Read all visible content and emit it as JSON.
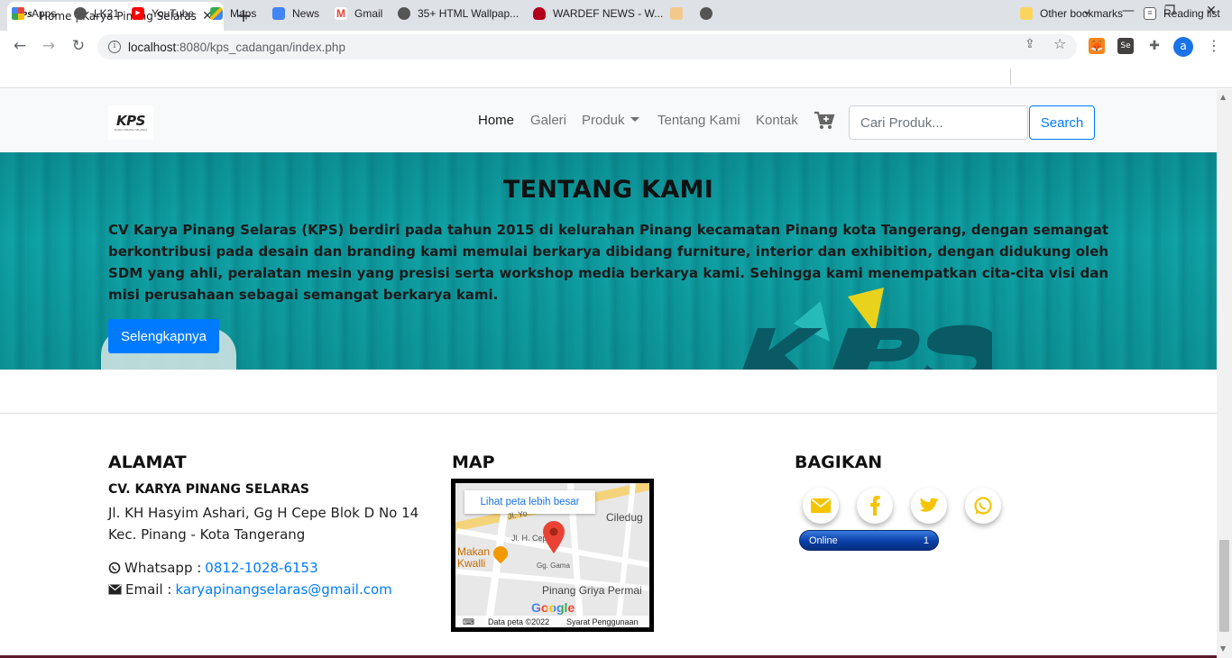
{
  "browser": {
    "tab_title": "Home | Karya Pinang Selaras",
    "tab_favicon_text": "KPS",
    "url_host": "localhost",
    "url_rest": ":8080/kps_cadangan/index.php",
    "avatar_letter": "a",
    "bookmarks": [
      {
        "label": "Apps",
        "icon": "apps-grid-icon"
      },
      {
        "label": "LK21",
        "icon": "globe-icon"
      },
      {
        "label": "YouTube",
        "icon": "youtube-icon"
      },
      {
        "label": "Maps",
        "icon": "maps-icon"
      },
      {
        "label": "News",
        "icon": "news-icon"
      },
      {
        "label": "Gmail",
        "icon": "gmail-icon"
      },
      {
        "label": "35+ HTML Wallpap...",
        "icon": "globe-icon"
      },
      {
        "label": "WARDEF NEWS - W...",
        "icon": "wardef-icon"
      }
    ],
    "other_bookmarks": "Other bookmarks",
    "reading_list": "Reading list"
  },
  "nav": {
    "logo_text": "KPS",
    "logo_sub": "KARYA PINANG SELARAS",
    "links": [
      "Home",
      "Galeri",
      "Produk",
      "Tentang Kami",
      "Kontak"
    ],
    "search_placeholder": "Cari Produk...",
    "search_button": "Search"
  },
  "hero": {
    "title": "TENTANG KAMI",
    "body": "CV Karya Pinang Selaras (KPS) berdiri pada tahun 2015 di kelurahan Pinang kecamatan Pinang kota Tangerang, dengan semangat berkontribusi pada desain dan branding kami memulai berkarya dibidang furniture, interior dan exhibition, dengan didukung oleh SDM yang ahli, peralatan mesin yang presisi serta workshop media berkarya kami. Sehingga kami menempatkan cita-cita visi dan misi perusahaan sebagai semangat berkarya kami.",
    "button": "Selengkapnya"
  },
  "footer": {
    "address_heading": "ALAMAT",
    "company": "CV. KARYA PINANG SELARAS",
    "address": "Jl. KH Hasyim Ashari, Gg H Cepe Blok D No 14 Kec. Pinang - Kota Tangerang",
    "whatsapp_label": "Whatsapp :",
    "whatsapp_value": "0812-1028-6153",
    "email_label": "Email :",
    "email_value": "karyapinangselaras@gmail.com",
    "map_heading": "MAP",
    "map_link": "Lihat peta lebih besar",
    "map_labels": [
      "Ciledug",
      "Makan Kwalli",
      "Pinang Griya Permai",
      "Jl. H. Cepe",
      "Gg. Gama",
      "Jl. Yo"
    ],
    "map_data": "Data peta ©2022",
    "map_terms": "Syarat Penggunaan",
    "map_google": "Google",
    "share_heading": "BAGIKAN",
    "share_buttons": [
      "email-icon",
      "facebook-icon",
      "twitter-icon",
      "whatsapp-icon"
    ],
    "online_label": "Online",
    "online_count": "1"
  },
  "colors": {
    "primary": "#007bff",
    "hero_teal": "#0d9a9e",
    "share_yellow": "#f5c400"
  }
}
